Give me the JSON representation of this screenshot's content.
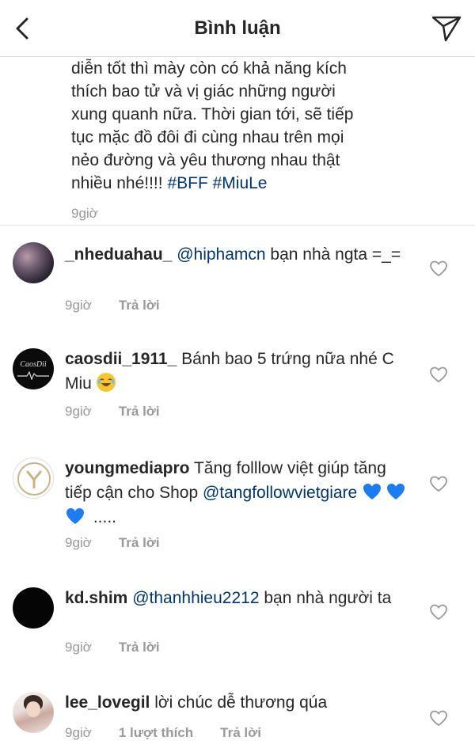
{
  "header": {
    "title": "Bình luận"
  },
  "caption": {
    "text": "diễn tốt thì mày còn có khả năng kích\nthích bao tử và vị giác những người\nxung quanh nữa. Thời gian tới, sẽ tiếp\ntục mặc đồ đôi đi cùng nhau trên mọi\nnẻo đường và yêu thương nhau thật\nnhiều nhé!!!! ",
    "hashtags": "#BFF #MiuLe",
    "time": "9giờ"
  },
  "comments": [
    {
      "username": "_nheduahau_",
      "mention": "@hiphamcn",
      "text": " bạn nhà ngta =_=",
      "time": "9giờ",
      "reply": "Trả lời"
    },
    {
      "username": "caosdii_1911_",
      "text": " Bánh bao 5 trứng nữa nhé C Miu ",
      "avatar_text": "CaosDii",
      "time": "9giờ",
      "reply": "Trả lời"
    },
    {
      "username": "youngmediapro",
      "text": " Tăng folllow việt giúp tăng tiếp cận cho Shop ",
      "mention": "@tangfollowvietgiare",
      "tail": " .....",
      "time": "9giờ",
      "reply": "Trả lời"
    },
    {
      "username": "kd.shim",
      "mention": "@thanhhieu2212",
      "text": "  bạn nhà người ta",
      "time": "9giờ",
      "reply": "Trả lời"
    },
    {
      "username": "lee_lovegil",
      "text": " lời chúc dễ thương qúa",
      "time": "9giờ",
      "likes": "1 lượt thích",
      "reply": "Trả lời"
    }
  ],
  "colors": {
    "text": "#262626",
    "link": "#003569",
    "meta": "#999999",
    "divider": "#dcdcdc"
  }
}
